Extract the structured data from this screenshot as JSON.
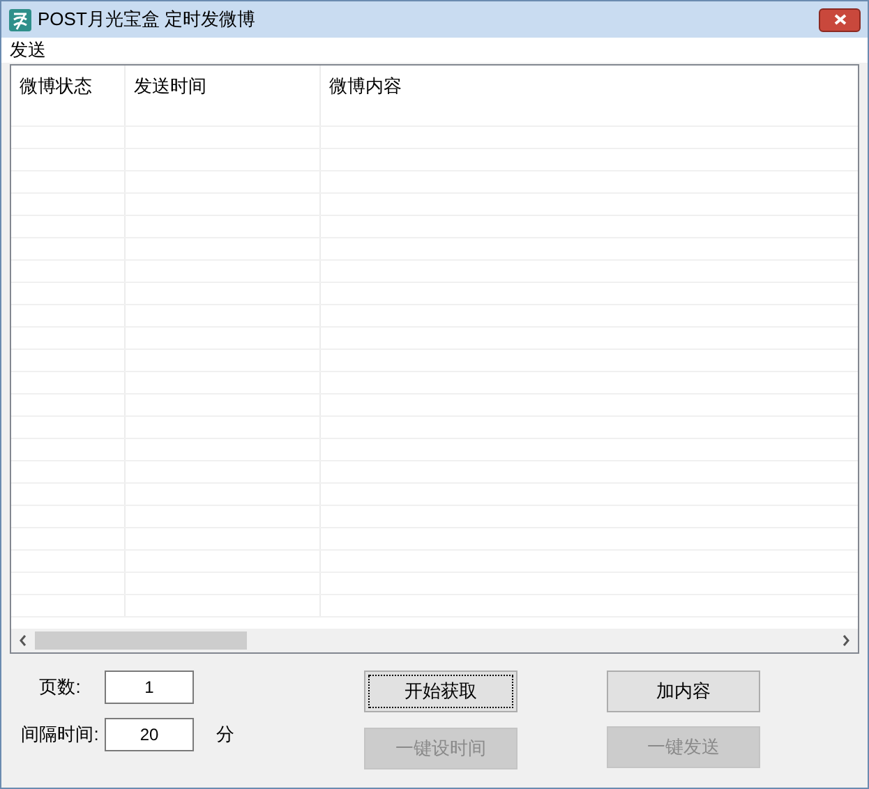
{
  "window": {
    "title": "POST月光宝盒 定时发微博"
  },
  "menu": [
    "发送"
  ],
  "table": {
    "columns": [
      "微博状态",
      "发送时间",
      "微博内容"
    ]
  },
  "fields": [
    {
      "label": "页数:",
      "value": "1"
    },
    {
      "label": "间隔时间:",
      "value": "20",
      "unit": "分"
    }
  ],
  "buttons": [
    {
      "label": "开始获取",
      "disabled": false,
      "focused": true
    },
    {
      "label": "加内容",
      "disabled": false,
      "focused": false
    },
    {
      "label": "一键设时间",
      "disabled": true,
      "focused": false
    },
    {
      "label": "一键发送",
      "disabled": true,
      "focused": false
    }
  ]
}
